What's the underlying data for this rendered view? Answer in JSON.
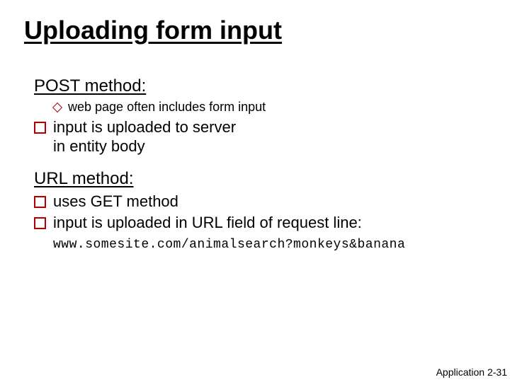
{
  "title": "Uploading form input",
  "post": {
    "heading": "POST method:",
    "sub1": "web page often includes form input",
    "point1": "input is uploaded to server in entity body"
  },
  "url": {
    "heading": "URL method:",
    "point1": "uses GET method",
    "point2_prefix": "input is uploaded in URL field of request line:",
    "example": "www.somesite.com/animalsearch?monkeys&banana"
  },
  "footer": "Application  2-31"
}
